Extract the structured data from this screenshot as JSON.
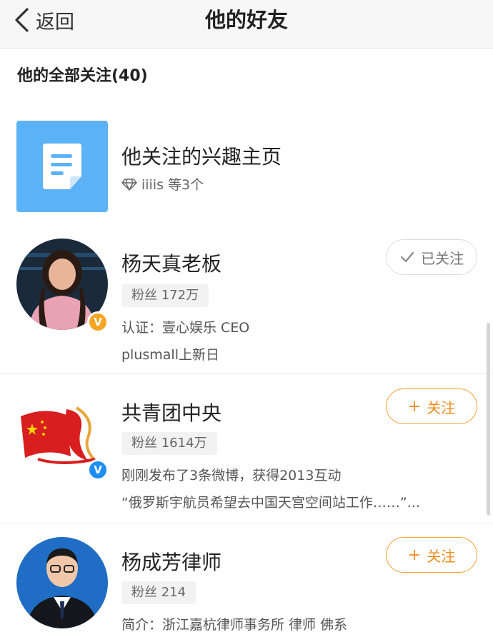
{
  "navbar": {
    "back_label": "返回",
    "title": "他的好友"
  },
  "section": {
    "header": "他的全部关注(40)"
  },
  "interest": {
    "title": "他关注的兴趣主页",
    "subtitle": "iiiis 等3个"
  },
  "users": [
    {
      "name": "杨天真老板",
      "fans": "粉丝 172万",
      "line1": "认证：壹心娱乐 CEO",
      "line2": "plusmall上新日",
      "button": "已关注",
      "badge": "V",
      "badge_color": "#f5a623"
    },
    {
      "name": "共青团中央",
      "fans": "粉丝 1614万",
      "line1": "刚刚发布了3条微博，获得2013互动",
      "line2": "“俄罗斯宇航员希望去中国天宫空间站工作……”...",
      "button": "关注",
      "badge": "V",
      "badge_color": "#1e8ef5"
    },
    {
      "name": "杨成芳律师",
      "fans": "粉丝 214",
      "line1": "简介：浙江嘉杭律师事务所 律师 佛系",
      "button": "关注"
    }
  ],
  "colors": {
    "accent": "#f08d1c",
    "nav_bg": "#f7f7f7",
    "doc_tile": "#5bb2f7"
  }
}
